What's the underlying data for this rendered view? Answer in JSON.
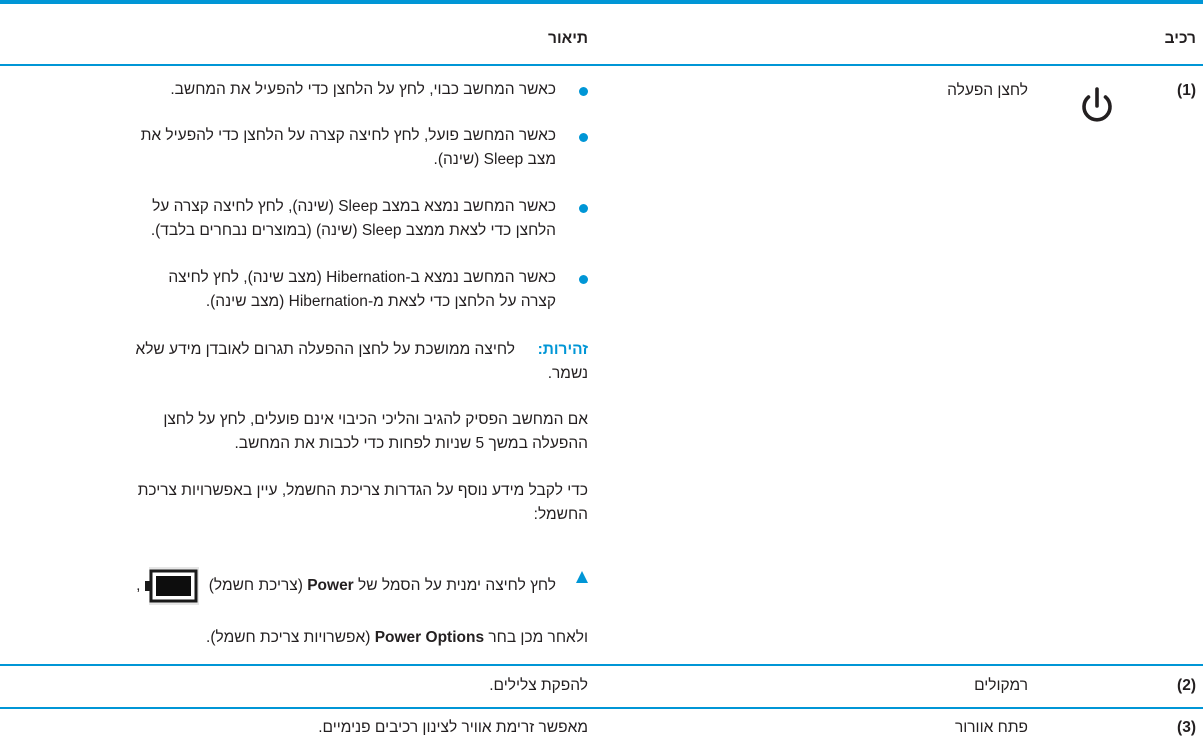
{
  "header": {
    "col_component": "רכיב",
    "col_description": "תיאור"
  },
  "rows": [
    {
      "number": "(1)",
      "name": "לחצן הפעלה",
      "icon": "power-icon",
      "bullets": [
        {
          "line1": "כאשר המחשב כבוי, לחץ על הלחצן כדי להפעיל את המחשב."
        },
        {
          "line1": "כאשר המחשב פועל, לחץ לחיצה קצרה על הלחצן כדי להפעיל את",
          "line2": "מצב Sleep (שינה)."
        },
        {
          "line1": "כאשר המחשב נמצא במצב Sleep (שינה), לחץ לחיצה קצרה על",
          "line2": "הלחצן כדי לצאת ממצב Sleep (שינה) (במוצרים נבחרים בלבד)."
        },
        {
          "line1": "כאשר המחשב נמצא ב-Hibernation (מצב שינה), לחץ לחיצה",
          "line2": "קצרה על הלחצן כדי לצאת מ-Hibernation (מצב שינה)."
        }
      ],
      "warning": {
        "label": "זהירות:",
        "line1": "לחיצה ממושכת על לחצן ההפעלה תגרום לאובדן מידע שלא",
        "line2": "נשמר."
      },
      "para1": {
        "line1": "אם המחשב הפסיק להגיב והליכי הכיבוי אינם פועלים, לחץ על לחצן",
        "line2": "ההפעלה במשך 5 שניות לפחות כדי לכבות את המחשב."
      },
      "para2": {
        "line1": "כדי לקבל מידע נוסף על הגדרות צריכת החשמל, עיין באפשרויות צריכת",
        "line2": "החשמל:"
      },
      "step": {
        "pre": "לחץ לחיצה ימנית על הסמל של ",
        "bold1": "Power",
        "mid": " (צריכת חשמל) ",
        "battery_icon": "battery-icon",
        "comma": ",",
        "line2_pre": "ולאחר מכן בחר ",
        "bold2": "Power Options",
        "line2_post": " (אפשרויות צריכת חשמל)."
      }
    },
    {
      "number": "(2)",
      "name": "רמקולים",
      "description": "להפקת צלילים."
    },
    {
      "number": "(3)",
      "name": "פתח אוורור",
      "description": "מאפשר זרימת אוויר לצינון רכיבים פנימיים."
    }
  ],
  "colors": {
    "accent": "#0096d6",
    "text": "#231f20"
  }
}
